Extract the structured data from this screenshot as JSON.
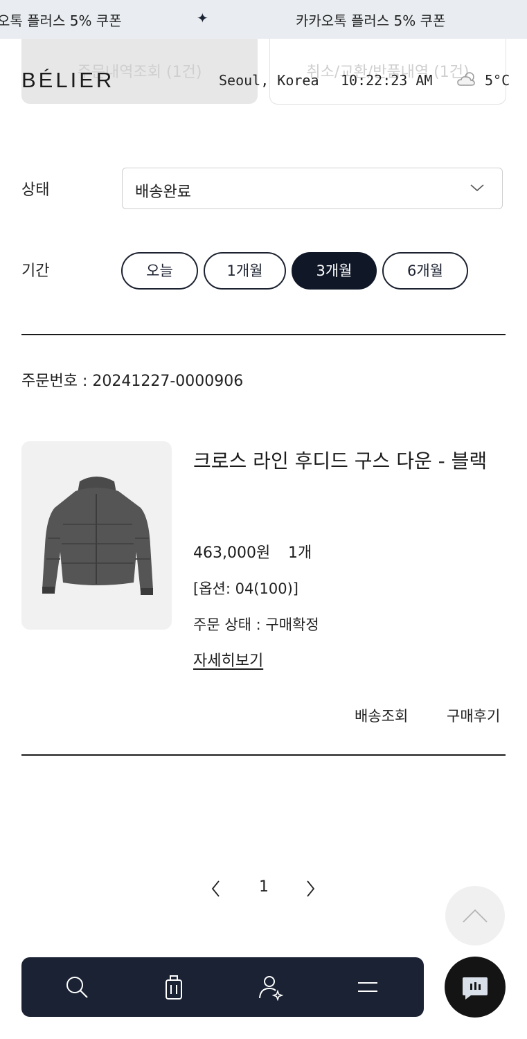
{
  "marquee": {
    "text_left": "오톡 플러스 5% 쿠폰",
    "separator": "✦",
    "text_right": "카카오톡 플러스 5% 쿠폰"
  },
  "tabs": {
    "orders": "주문내역조회 (1건)",
    "cancel": "취소/교환/반품내역 (1건)"
  },
  "header": {
    "logo": "BÉLIER",
    "location": "Seoul, Korea",
    "time": "10:22:23 AM",
    "temperature": "5°C",
    "weather_icon": "partly-cloudy-icon"
  },
  "filters": {
    "status_label": "상태",
    "status_value": "배송완료",
    "period_label": "기간",
    "periods": [
      "오늘",
      "1개월",
      "3개월",
      "6개월"
    ],
    "selected_period": "3개월"
  },
  "order": {
    "number_text": "주문번호 : 20241227-0000906",
    "product_name": "크로스 라인 후디드 구스 다운 - 블랙",
    "price": "463,000원",
    "quantity": "1개",
    "option": "[옵션: 04(100)]",
    "status": "주문 상태 : 구매확정",
    "detail_link": "자세히보기",
    "actions": [
      "배송조회",
      "구매후기"
    ]
  },
  "pagination": {
    "current": "1"
  },
  "colors": {
    "navy": "#1b2233",
    "marquee_bg": "#e9edf1",
    "active_pill": "#101828"
  }
}
